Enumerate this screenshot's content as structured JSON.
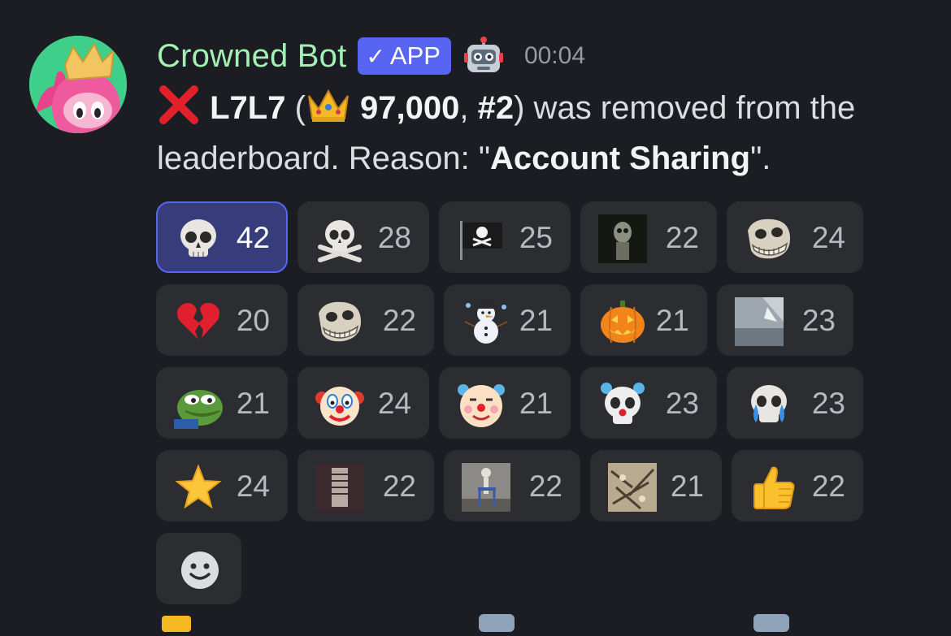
{
  "author": {
    "name": "Crowned Bot",
    "badge": "APP",
    "badge_check": "✓",
    "timestamp": "00:04",
    "name_color": "#a3f0b4",
    "avatar_icon": "fall-guys-crown-avatar",
    "robot_icon": "robot-icon"
  },
  "message": {
    "user": "L7L7",
    "open_paren": " (",
    "crowns": "97,000",
    "sep1": ", ",
    "rank": "#2",
    "mid": ") was removed from the leaderboard. Reason: \"",
    "reason": "Account Sharing",
    "end": "\"."
  },
  "reactions": [
    {
      "icon": "skull",
      "count": "42",
      "active": true
    },
    {
      "icon": "skull-and-crossbones",
      "count": "28"
    },
    {
      "icon": "pirate-flag",
      "count": "25"
    },
    {
      "icon": "custom-skeleton-image",
      "count": "22"
    },
    {
      "icon": "custom-troll-skull",
      "count": "24"
    },
    {
      "icon": "broken-heart",
      "count": "20"
    },
    {
      "icon": "custom-troll-skull",
      "count": "22"
    },
    {
      "icon": "snowman",
      "count": "21"
    },
    {
      "icon": "jack-o-lantern",
      "count": "21"
    },
    {
      "icon": "custom-blurry-image",
      "count": "23"
    },
    {
      "icon": "custom-pepe-frog",
      "count": "21"
    },
    {
      "icon": "clown-face",
      "count": "24"
    },
    {
      "icon": "custom-clown",
      "count": "21"
    },
    {
      "icon": "custom-clown-skull",
      "count": "23"
    },
    {
      "icon": "custom-crying-skull",
      "count": "23"
    },
    {
      "icon": "star",
      "count": "24"
    },
    {
      "icon": "custom-skeleton-image",
      "count": "22"
    },
    {
      "icon": "custom-skeleton-walker",
      "count": "22"
    },
    {
      "icon": "custom-skeleton-pile",
      "count": "21"
    },
    {
      "icon": "thumbs-up",
      "count": "22"
    }
  ],
  "add_reaction_icon": "add-reaction-smiley-icon",
  "colors": {
    "background": "#1c1d22",
    "reaction_bg": "#2b2d31",
    "reaction_active_bg": "#373c7a",
    "accent": "#5865f2"
  }
}
